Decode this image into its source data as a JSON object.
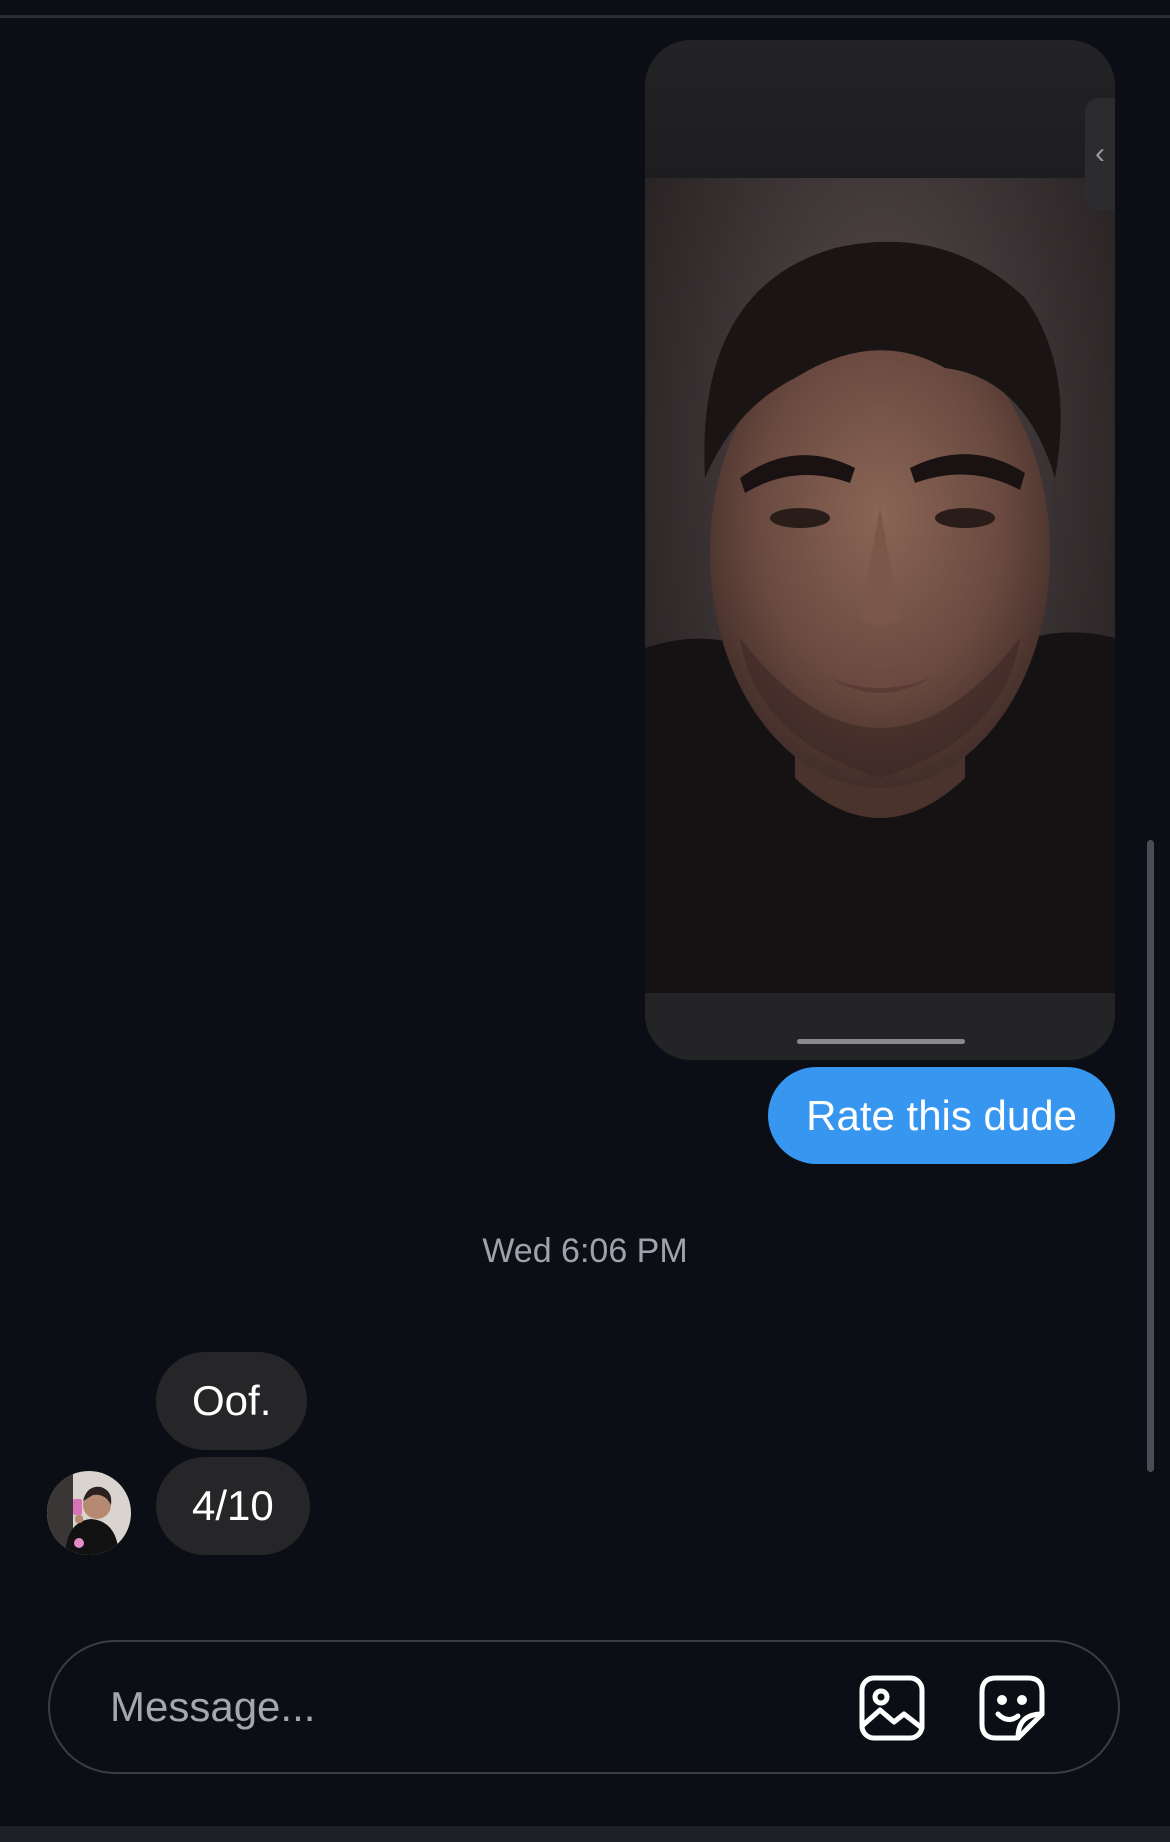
{
  "conversation": {
    "shared_photo": {
      "alt": "shared photo",
      "side_tab_glyph": "‹"
    },
    "outgoing_message": "Rate this dude",
    "timestamp": "Wed 6:06 PM",
    "incoming_messages": [
      "Oof.",
      "4/10"
    ]
  },
  "composer": {
    "placeholder": "Message...",
    "icons": [
      "gallery-icon",
      "sticker-icon"
    ]
  },
  "colors": {
    "background": "#0b0e14",
    "outgoing_bubble": "#3797f0",
    "incoming_bubble": "#262628"
  }
}
